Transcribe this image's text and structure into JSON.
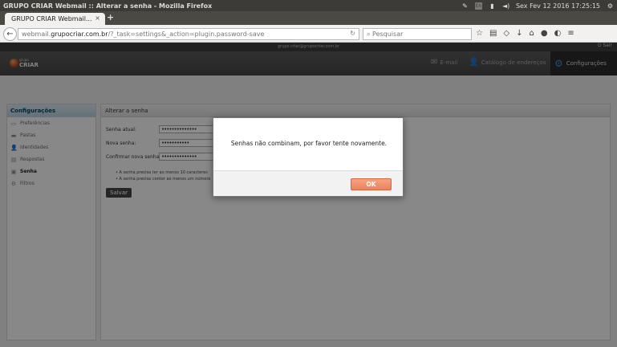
{
  "os": {
    "window_title": "GRUPO CRIAR Webmail :: Alterar a senha - Mozilla Firefox",
    "datetime": "Sex Fev 12 2016 17:25:15",
    "en_badge": "En"
  },
  "browser": {
    "tab_title": "GRUPO CRIAR Webmail...",
    "tab_close": "×",
    "new_tab": "+",
    "url_prefix": "webmail.",
    "url_domain": "grupocriar.com.br",
    "url_path": "/?_task=settings&_action=plugin.password-save",
    "search_placeholder": "Pesquisar"
  },
  "app": {
    "user_email": "grupo.criar@grupocriar.com.br",
    "logout_label": "Sair",
    "logo_small": "grupo",
    "logo_text": "CRIAR",
    "nav": {
      "email_label": "E-mail",
      "contacts_label": "Catálogo de endereços",
      "settings_label": "Configurações"
    },
    "sidebar": {
      "title": "Configurações",
      "items": [
        {
          "label": "Preferências",
          "icon": "preferences-icon"
        },
        {
          "label": "Pastas",
          "icon": "folder-icon"
        },
        {
          "label": "Identidades",
          "icon": "identity-icon"
        },
        {
          "label": "Respostas",
          "icon": "responses-icon"
        },
        {
          "label": "Senha",
          "icon": "password-icon"
        },
        {
          "label": "Filtros",
          "icon": "filter-icon"
        }
      ]
    },
    "content": {
      "title": "Alterar a senha",
      "current_label": "Senha atual:",
      "current_value": "••••••••••••••",
      "new_label": "Nova senha:",
      "new_value": "•••••••••••",
      "confirm_label": "Confirmar nova senha:",
      "confirm_value": "••••••••••••••",
      "hint1": "A senha precisa ter ao menos 10 caracteres",
      "hint2": "A senha precisa conter ao menos um número",
      "save_label": "Salvar"
    }
  },
  "dialog": {
    "message": "Senhas não combinam, por favor tente novamente.",
    "ok_label": "OK"
  }
}
